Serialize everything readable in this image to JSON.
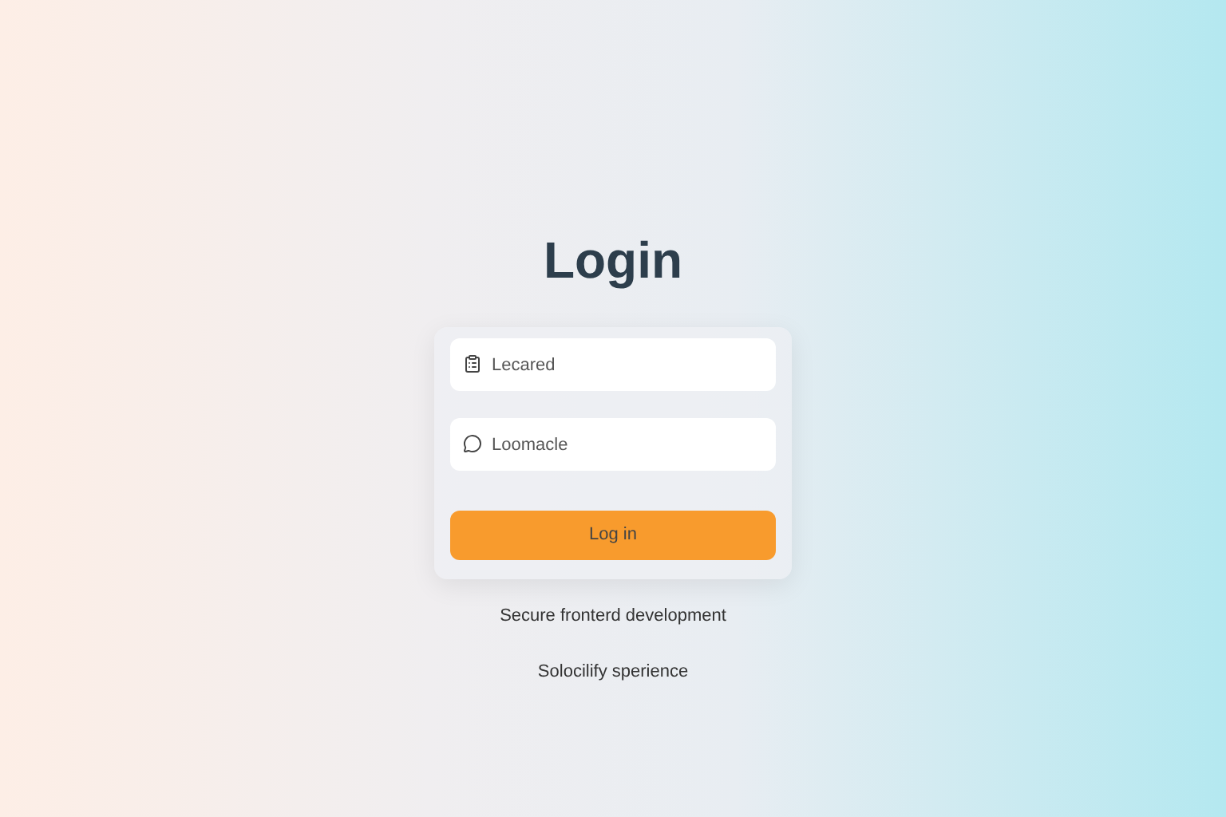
{
  "title": "Login",
  "fields": [
    {
      "kind": "bag",
      "placeholder": "Lecared"
    },
    {
      "kind": "chat",
      "placeholder": "Loomacle"
    }
  ],
  "button": "Log in",
  "taglines": [
    "Secure fronterd development",
    "Solocilify sperience"
  ]
}
